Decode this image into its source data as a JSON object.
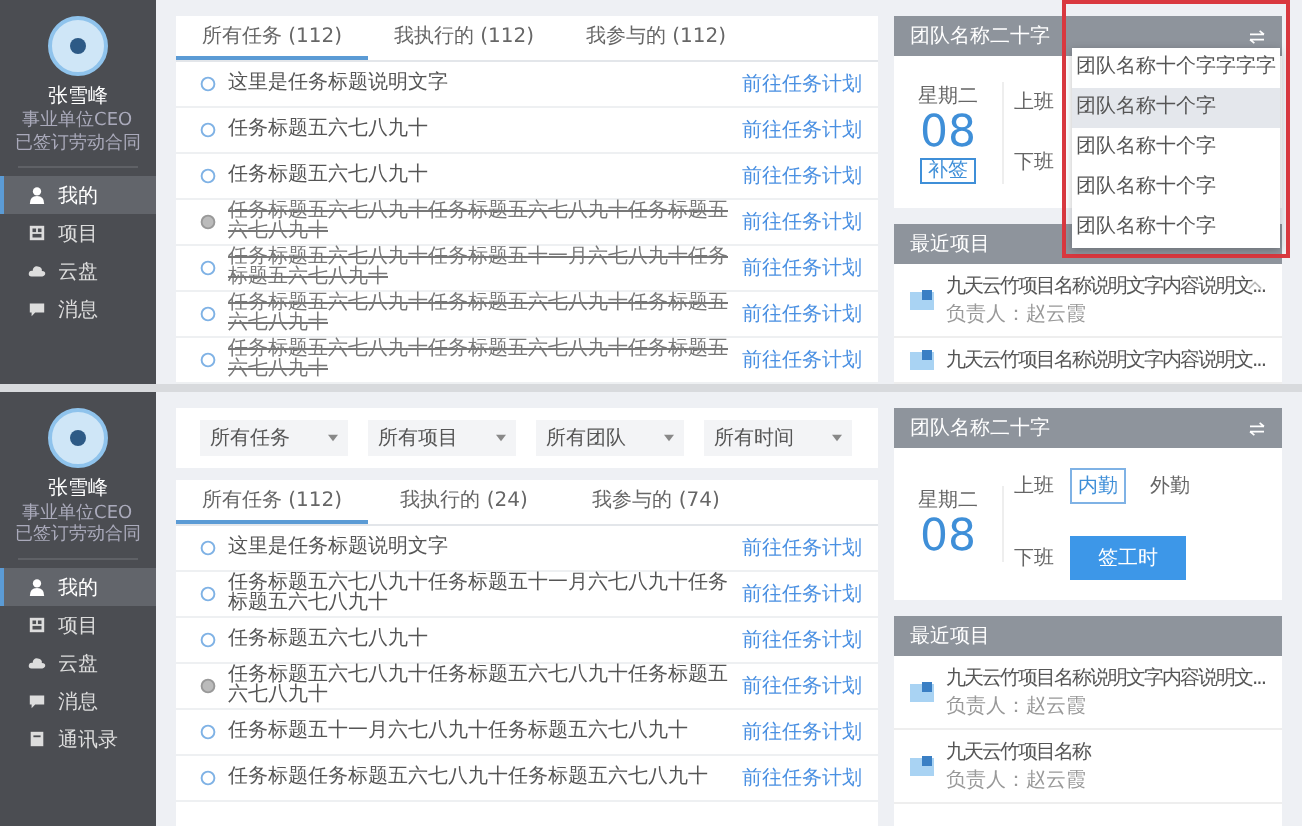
{
  "screens": [
    {
      "sidebar": {
        "name": "张雪峰",
        "lines": [
          "事业单位CEO",
          "已签订劳动合同"
        ],
        "items": [
          {
            "label": "我的",
            "selected": true
          },
          {
            "label": "项目",
            "selected": false
          },
          {
            "label": "云盘",
            "selected": false
          },
          {
            "label": "消息",
            "selected": false
          }
        ]
      },
      "tabs": [
        {
          "label": "所有任务 (112)",
          "selected": true
        },
        {
          "label": "我执行的 (112)",
          "selected": false
        },
        {
          "label": "我参与的 (112)",
          "selected": false
        }
      ],
      "tasks": [
        {
          "title": "这里是任务标题说明文字",
          "link": "前往任务计划",
          "checked": false,
          "struck": false
        },
        {
          "title": "任务标题五六七八九十",
          "link": "前往任务计划",
          "checked": false,
          "struck": false
        },
        {
          "title": "任务标题五六七八九十",
          "link": "前往任务计划",
          "checked": false,
          "struck": false
        },
        {
          "title": "任务标题五六七八九十任务标题五六七八九十任务标题五六七八九十",
          "link": "前往任务计划",
          "checked": true,
          "struck": true
        },
        {
          "title": "任务标题五六七八九十任务标题五十一月六七八九十任务标题五六七八九十",
          "link": "前往任务计划",
          "checked": false,
          "struck": true
        },
        {
          "title": "任务标题五六七八九十任务标题五六七八九十任务标题五六七八九十",
          "link": "前往任务计划",
          "checked": false,
          "struck": true
        },
        {
          "title": "任务标题五六七八九十任务标题五六七八九十任务标题五六七八九十",
          "link": "前往任务计划",
          "checked": false,
          "struck": true
        }
      ],
      "team": {
        "title": "团队名称二十字",
        "weekday": "星期二",
        "day": "08",
        "badge": "补签",
        "shifts": [
          {
            "label": "上班"
          },
          {
            "label": "下班"
          }
        ]
      },
      "dropdown": {
        "items": [
          {
            "label": "团队名称十个字字字字",
            "selected": false
          },
          {
            "label": "团队名称十个字",
            "selected": true
          },
          {
            "label": "团队名称十个字",
            "selected": false
          },
          {
            "label": "团队名称十个字",
            "selected": false
          },
          {
            "label": "团队名称十个字",
            "selected": false
          }
        ]
      },
      "recent": {
        "title": "最近项目",
        "items": [
          {
            "title": "九天云竹项目名称说明文字内容说明文...",
            "owner": "负责人：赵云霞",
            "expandable": true
          },
          {
            "title": "九天云竹项目名称说明文字内容说明文...",
            "expandable": false
          }
        ]
      }
    },
    {
      "sidebar": {
        "name": "张雪峰",
        "lines": [
          "事业单位CEO",
          "已签订劳动合同"
        ],
        "items": [
          {
            "label": "我的",
            "selected": true
          },
          {
            "label": "项目",
            "selected": false
          },
          {
            "label": "云盘",
            "selected": false
          },
          {
            "label": "消息",
            "selected": false
          },
          {
            "label": "通讯录",
            "selected": false
          }
        ]
      },
      "filters": [
        "所有任务",
        "所有项目",
        "所有团队",
        "所有时间"
      ],
      "tabs": [
        {
          "label": "所有任务 (112)",
          "selected": true
        },
        {
          "label": "我执行的 (24)",
          "selected": false
        },
        {
          "label": "我参与的 (74)",
          "selected": false
        }
      ],
      "tasks": [
        {
          "title": "这里是任务标题说明文字",
          "link": "前往任务计划",
          "checked": false,
          "struck": false
        },
        {
          "title": "任务标题五六七八九十任务标题五十一月六七八九十任务标题五六七八九十",
          "link": "前往任务计划",
          "checked": false,
          "struck": false
        },
        {
          "title": "任务标题五六七八九十",
          "link": "前往任务计划",
          "checked": false,
          "struck": false
        },
        {
          "title": "任务标题五六七八九十任务标题五六七八九十任务标题五六七八九十",
          "link": "前往任务计划",
          "checked": true,
          "struck": false
        },
        {
          "title": "任务标题五十一月六七八九十任务标题五六七八九十",
          "link": "前往任务计划",
          "checked": false,
          "struck": false
        },
        {
          "title": "任务标题任务标题五六七八九十任务标题五六七八九十",
          "link": "前往任务计划",
          "checked": false,
          "struck": false
        }
      ],
      "team": {
        "title": "团队名称二十字",
        "weekday": "星期二",
        "day": "08",
        "shifts": [
          {
            "label": "上班",
            "options": [
              {
                "label": "内勤",
                "selected": true
              },
              {
                "label": "外勤",
                "selected": false
              }
            ]
          },
          {
            "label": "下班",
            "button": "签工时"
          }
        ]
      },
      "recent": {
        "title": "最近项目",
        "items": [
          {
            "title": "九天云竹项目名称说明文字内容说明文...",
            "owner": "负责人：赵云霞",
            "expandable": false
          },
          {
            "title": "九天云竹项目名称",
            "owner": "负责人：赵云霞",
            "expandable": false
          }
        ]
      }
    }
  ]
}
